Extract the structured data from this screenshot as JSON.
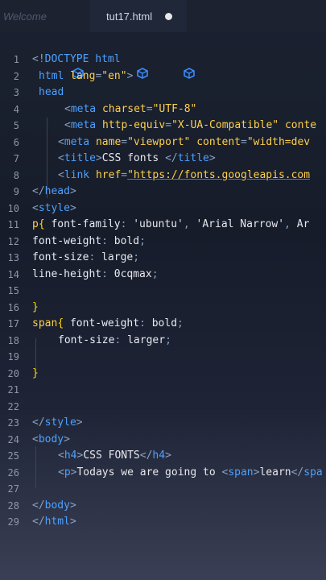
{
  "tabs": [
    {
      "label": "Welcome"
    },
    {
      "label": "tut17.html"
    }
  ],
  "lines": [
    {
      "n": "1",
      "parts": [
        [
          "punc",
          "<!"
        ],
        [
          "tag",
          "DOCTYPE"
        ],
        [
          "txt",
          " "
        ],
        [
          "tag",
          "html"
        ]
      ]
    },
    {
      "n": "2",
      "parts": [
        [
          "tag",
          "html"
        ],
        [
          "txt",
          " "
        ],
        [
          "attr",
          "lang"
        ],
        [
          "punc",
          "="
        ],
        [
          "str",
          "\"en\""
        ],
        [
          "punc",
          ">"
        ]
      ]
    },
    {
      "n": "3",
      "parts": [
        [
          "tag",
          "head"
        ]
      ]
    },
    {
      "n": "4",
      "parts": [
        [
          "punc",
          "<"
        ],
        [
          "tag",
          "meta"
        ],
        [
          "txt",
          " "
        ],
        [
          "attr",
          "charset"
        ],
        [
          "punc",
          "="
        ],
        [
          "str",
          "\"UTF-8\""
        ]
      ]
    },
    {
      "n": "5",
      "parts": [
        [
          "punc",
          "<"
        ],
        [
          "tag",
          "meta"
        ],
        [
          "txt",
          " "
        ],
        [
          "attr",
          "http-equiv"
        ],
        [
          "punc",
          "="
        ],
        [
          "str",
          "\"X-UA-Compatible\""
        ],
        [
          "txt",
          " "
        ],
        [
          "attr",
          "conte"
        ]
      ]
    },
    {
      "n": "6",
      "parts": [
        [
          "punc",
          "<"
        ],
        [
          "tag",
          "meta"
        ],
        [
          "txt",
          " "
        ],
        [
          "attr",
          "name"
        ],
        [
          "punc",
          "="
        ],
        [
          "str",
          "\"viewport\""
        ],
        [
          "txt",
          " "
        ],
        [
          "attr",
          "content"
        ],
        [
          "punc",
          "="
        ],
        [
          "str",
          "\"width=dev"
        ]
      ]
    },
    {
      "n": "7",
      "parts": [
        [
          "punc",
          "<"
        ],
        [
          "tag",
          "title"
        ],
        [
          "punc",
          ">"
        ],
        [
          "txt",
          "CSS fonts "
        ],
        [
          "punc",
          "</"
        ],
        [
          "tag",
          "title"
        ],
        [
          "punc",
          ">"
        ]
      ]
    },
    {
      "n": "8",
      "parts": [
        [
          "punc",
          "<"
        ],
        [
          "tag",
          "link"
        ],
        [
          "txt",
          " "
        ],
        [
          "attr",
          "href"
        ],
        [
          "punc",
          "="
        ],
        [
          "link",
          "\"https://fonts.googleapis.com"
        ]
      ]
    },
    {
      "n": "9",
      "parts": [
        [
          "punc",
          "</"
        ],
        [
          "tag",
          "head"
        ],
        [
          "punc",
          ">"
        ]
      ]
    },
    {
      "n": "10",
      "parts": [
        [
          "punc",
          "<"
        ],
        [
          "tag",
          "style"
        ],
        [
          "punc",
          ">"
        ]
      ]
    },
    {
      "n": "11",
      "parts": [
        [
          "sel",
          "p"
        ],
        [
          "brace",
          "{"
        ],
        [
          "txt",
          " "
        ],
        [
          "prop",
          "font-family"
        ],
        [
          "punc",
          ":"
        ],
        [
          "txt",
          " "
        ],
        [
          "val",
          "'ubuntu'"
        ],
        [
          "punc",
          ","
        ],
        [
          "txt",
          " "
        ],
        [
          "val",
          "'Arial Narrow'"
        ],
        [
          "punc",
          ","
        ],
        [
          "txt",
          " "
        ],
        [
          "val",
          "Ar"
        ]
      ]
    },
    {
      "n": "12",
      "parts": [
        [
          "prop",
          "font-weight"
        ],
        [
          "punc",
          ":"
        ],
        [
          "txt",
          " "
        ],
        [
          "val",
          "bold"
        ],
        [
          "punc",
          ";"
        ]
      ]
    },
    {
      "n": "13",
      "parts": [
        [
          "prop",
          "font-size"
        ],
        [
          "punc",
          ":"
        ],
        [
          "txt",
          " "
        ],
        [
          "val",
          "large"
        ],
        [
          "punc",
          ";"
        ]
      ]
    },
    {
      "n": "14",
      "parts": [
        [
          "prop",
          "line-height"
        ],
        [
          "punc",
          ":"
        ],
        [
          "txt",
          " "
        ],
        [
          "val",
          "0cqmax"
        ],
        [
          "punc",
          ";"
        ]
      ]
    },
    {
      "n": "15",
      "parts": []
    },
    {
      "n": "16",
      "parts": [
        [
          "brace",
          "}"
        ]
      ]
    },
    {
      "n": "17",
      "parts": [
        [
          "sel",
          "span"
        ],
        [
          "brace",
          "{"
        ],
        [
          "txt",
          " "
        ],
        [
          "prop",
          "font-weight"
        ],
        [
          "punc",
          ":"
        ],
        [
          "txt",
          " "
        ],
        [
          "val",
          "bold"
        ],
        [
          "punc",
          ";"
        ]
      ]
    },
    {
      "n": "18",
      "parts": [
        [
          "prop",
          "font-size"
        ],
        [
          "punc",
          ":"
        ],
        [
          "txt",
          " "
        ],
        [
          "val",
          "larger"
        ],
        [
          "punc",
          ";"
        ]
      ]
    },
    {
      "n": "19",
      "parts": []
    },
    {
      "n": "20",
      "parts": [
        [
          "brace",
          "}"
        ]
      ]
    },
    {
      "n": "21",
      "parts": []
    },
    {
      "n": "22",
      "parts": []
    },
    {
      "n": "23",
      "parts": [
        [
          "punc",
          "</"
        ],
        [
          "tag",
          "style"
        ],
        [
          "punc",
          ">"
        ]
      ]
    },
    {
      "n": "24",
      "parts": [
        [
          "punc",
          "<"
        ],
        [
          "tag",
          "body"
        ],
        [
          "punc",
          ">"
        ]
      ]
    },
    {
      "n": "25",
      "parts": [
        [
          "punc",
          "<"
        ],
        [
          "tag",
          "h4"
        ],
        [
          "punc",
          ">"
        ],
        [
          "txt",
          "CSS FONTS"
        ],
        [
          "punc",
          "</"
        ],
        [
          "tag",
          "h4"
        ],
        [
          "punc",
          ">"
        ]
      ]
    },
    {
      "n": "26",
      "parts": [
        [
          "punc",
          "<"
        ],
        [
          "tag",
          "p"
        ],
        [
          "punc",
          ">"
        ],
        [
          "txt",
          "Todays we are going to "
        ],
        [
          "punc",
          "<"
        ],
        [
          "tag",
          "span"
        ],
        [
          "punc",
          ">"
        ],
        [
          "txt",
          "learn"
        ],
        [
          "punc",
          "</"
        ],
        [
          "tag",
          "spa"
        ]
      ]
    },
    {
      "n": "27",
      "parts": []
    },
    {
      "n": "28",
      "parts": [
        [
          "punc",
          "</"
        ],
        [
          "tag",
          "body"
        ],
        [
          "punc",
          ">"
        ]
      ]
    },
    {
      "n": "29",
      "parts": [
        [
          "punc",
          "</"
        ],
        [
          "tag",
          "html"
        ],
        [
          "punc",
          ">"
        ]
      ]
    }
  ],
  "colors": {
    "tag": "#4ea1ff",
    "attr": "#ffd04a",
    "text": "#e8e8ec",
    "brace": "#ffd700"
  }
}
